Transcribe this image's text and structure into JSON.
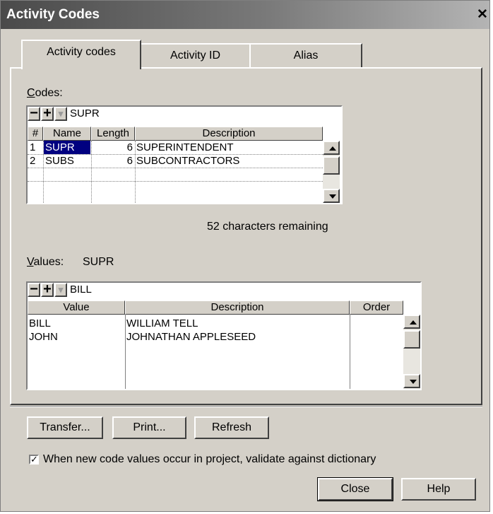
{
  "window": {
    "title": "Activity Codes",
    "close_glyph": "✕"
  },
  "tabs": [
    {
      "label": "Activity codes",
      "active": true
    },
    {
      "label": "Activity ID",
      "active": false
    },
    {
      "label": "Alias",
      "active": false
    }
  ],
  "codes": {
    "label_mnemonic": "C",
    "label_rest": "odes:",
    "toolbar": {
      "minus": "−",
      "plus": "+",
      "dropdown": "▾",
      "current_value": "SUPR"
    },
    "columns": [
      "#",
      "Name",
      "Length",
      "Description"
    ],
    "rows": [
      {
        "num": "1",
        "name": "SUPR",
        "length": "6",
        "description": "SUPERINTENDENT",
        "selected": true
      },
      {
        "num": "2",
        "name": "SUBS",
        "length": "6",
        "description": "SUBCONTRACTORS",
        "selected": false
      }
    ],
    "remaining_text": "52 characters remaining"
  },
  "values": {
    "label_mnemonic": "V",
    "label_rest": "alues:",
    "code_name": "SUPR",
    "toolbar": {
      "minus": "−",
      "plus": "+",
      "dropdown": "▾",
      "current_value": "BILL"
    },
    "columns": [
      "Value",
      "Description",
      "Order"
    ],
    "rows": [
      {
        "value": "BILL",
        "description": "WILLIAM TELL",
        "order": ""
      },
      {
        "value": "JOHN",
        "description": "JOHNATHAN APPLESEED",
        "order": ""
      }
    ]
  },
  "buttons": {
    "transfer": "Transfer...",
    "print": "Print...",
    "refresh": "Refresh",
    "close": "Close",
    "help": "Help"
  },
  "validate": {
    "label": "When new code values occur in project, validate against dictionary",
    "checked": true,
    "check_glyph": "✓"
  },
  "icons": [
    "close-icon",
    "minus-icon",
    "plus-icon",
    "dropdown-arrow-icon",
    "scroll-up-arrow-icon",
    "scroll-down-arrow-icon",
    "checkmark-icon"
  ],
  "colors": {
    "dialog_bg": "#d4d0c8",
    "selection_bg": "#000080",
    "selection_fg": "#ffffff",
    "grid_bg": "#ffffff"
  }
}
